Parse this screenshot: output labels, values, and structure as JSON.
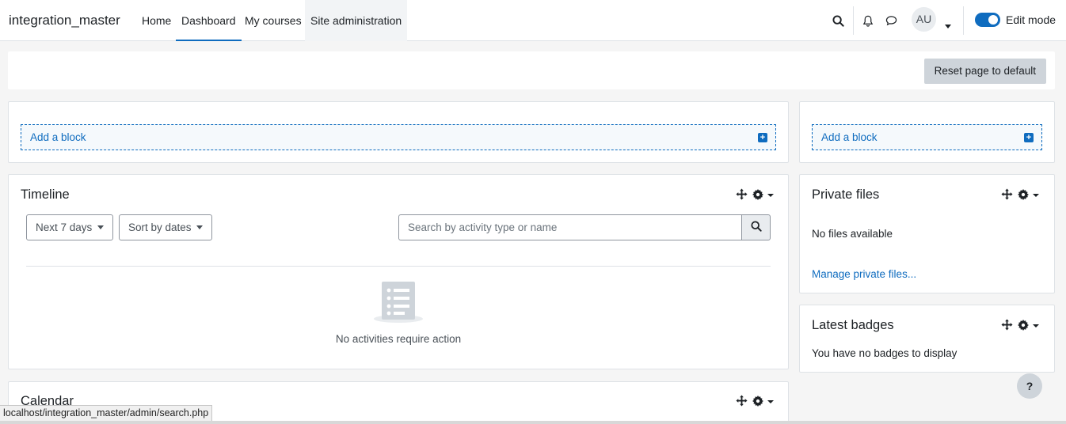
{
  "nav": {
    "brand": "integration_master",
    "links": [
      "Home",
      "Dashboard",
      "My courses",
      "Site administration"
    ],
    "avatar_initials": "AU",
    "edit_mode_label": "Edit mode",
    "edit_mode_on": true
  },
  "page": {
    "reset_label": "Reset page to default",
    "add_block_label": "Add a block"
  },
  "timeline": {
    "title": "Timeline",
    "filter_days": "Next 7 days",
    "sort": "Sort by dates",
    "search_placeholder": "Search by activity type or name",
    "empty_message": "No activities require action"
  },
  "calendar": {
    "title": "Calendar"
  },
  "private_files": {
    "title": "Private files",
    "empty_message": "No files available",
    "manage_link": "Manage private files..."
  },
  "latest_badges": {
    "title": "Latest badges",
    "empty_message": "You have no badges to display"
  },
  "help": {
    "label": "?"
  },
  "status_bar": {
    "url": "localhost/integration_master/admin/search.php"
  },
  "colors": {
    "primary": "#0f6cbf",
    "border": "#dee2e6",
    "button_gray": "#ced4da"
  }
}
